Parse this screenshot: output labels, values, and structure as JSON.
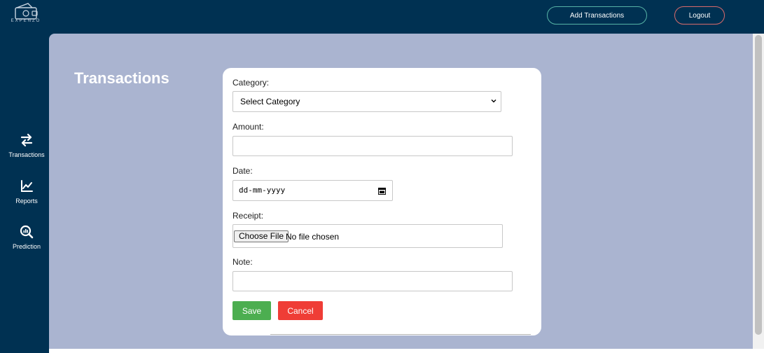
{
  "header": {
    "logo_text": "EXPENZO",
    "add_transactions_label": "Add Transactions",
    "logout_label": "Logout"
  },
  "sidebar": {
    "items": [
      {
        "label": "Transactions",
        "icon": "transfer-arrows-icon"
      },
      {
        "label": "Reports",
        "icon": "line-chart-icon"
      },
      {
        "label": "Prediction",
        "icon": "search-analytics-icon"
      }
    ]
  },
  "main": {
    "title": "Transactions"
  },
  "form": {
    "category_label": "Category:",
    "category_value": "Select Category",
    "amount_label": "Amount:",
    "amount_value": "",
    "date_label": "Date:",
    "date_placeholder": "dd-mm-yyyy",
    "receipt_label": "Receipt:",
    "choose_file_label": "Choose File",
    "file_status": "No file chosen",
    "note_label": "Note:",
    "note_value": "",
    "save_label": "Save",
    "cancel_label": "Cancel"
  },
  "colors": {
    "background": "#003152",
    "content": "#aab4d0",
    "save": "#4cae50",
    "cancel": "#ef3d36",
    "add_button_border": "#56b3a6",
    "logout_button_border": "#d96b6b"
  }
}
